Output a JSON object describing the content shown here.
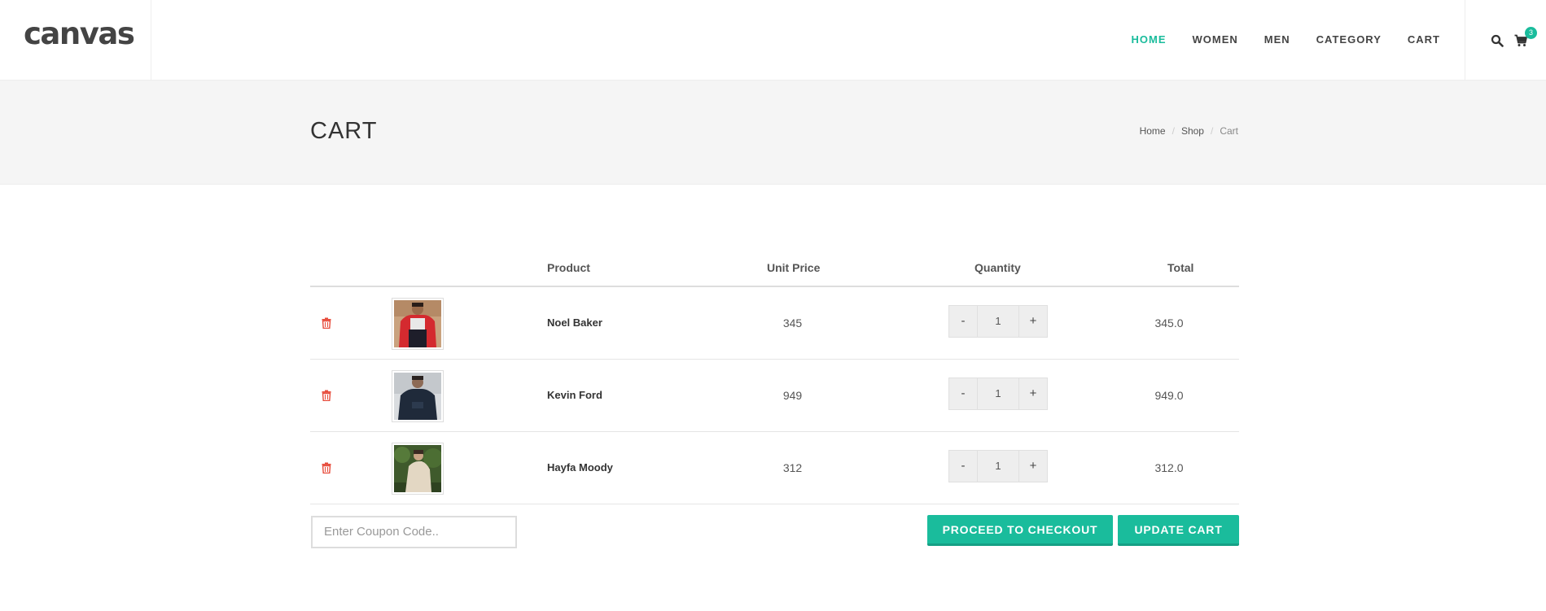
{
  "brand": {
    "logo": "canvas"
  },
  "nav": {
    "items": [
      {
        "label": "HOME",
        "active": true
      },
      {
        "label": "WOMEN",
        "active": false
      },
      {
        "label": "MEN",
        "active": false
      },
      {
        "label": "CATEGORY",
        "active": false
      },
      {
        "label": "CART",
        "active": false
      }
    ],
    "cart_count": "3",
    "accent_color": "#1ABC9C"
  },
  "page_title": {
    "title": "CART",
    "breadcrumb": [
      "Home",
      "Shop",
      "Cart"
    ]
  },
  "cart": {
    "headers": {
      "product": "Product",
      "unit_price": "Unit Price",
      "quantity": "Quantity",
      "total": "Total"
    },
    "rows": [
      {
        "name": "Noel Baker",
        "unit_price": "345",
        "quantity": "1",
        "total": "345.0",
        "image": "product-photo-red-jacket"
      },
      {
        "name": "Kevin Ford",
        "unit_price": "949",
        "quantity": "1",
        "total": "949.0",
        "image": "product-photo-navy-hoodie"
      },
      {
        "name": "Hayfa Moody",
        "unit_price": "312",
        "quantity": "1",
        "total": "312.0",
        "image": "product-photo-beige-outfit"
      }
    ],
    "minus_label": "-",
    "plus_label": "+"
  },
  "coupon": {
    "placeholder": "Enter Coupon Code.."
  },
  "actions": {
    "checkout_label": "PROCEED TO CHECKOUT",
    "update_label": "UPDATE CART"
  },
  "colors": {
    "accent": "#1ABC9C",
    "delete": "#e74c3c"
  }
}
